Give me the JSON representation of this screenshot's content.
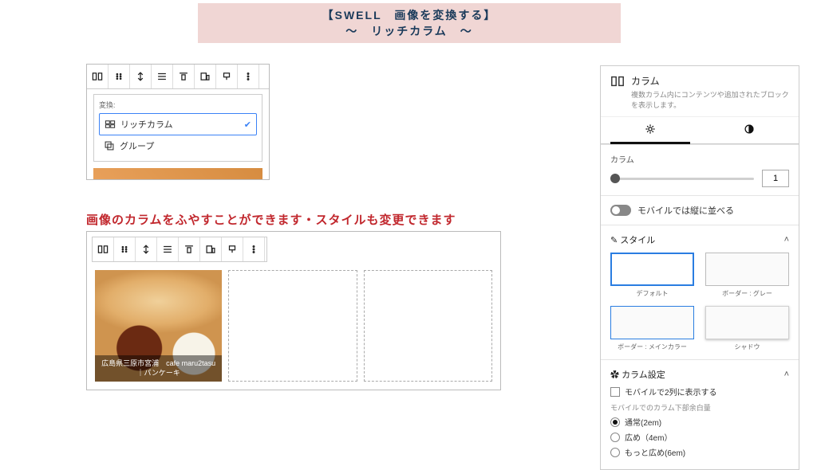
{
  "header": {
    "line1": "【SWELL　画像を変換する】",
    "line2": "〜　リッチカラム　〜"
  },
  "transform": {
    "label": "変換:",
    "options": {
      "rich_column": "リッチカラム",
      "group": "グループ"
    }
  },
  "caption": "画像のカラムをふやすことができます・スタイルも変更できます",
  "image": {
    "caption": "広島県三原市宮浦　cafe maru2tasu｜パンケーキ"
  },
  "sidebar": {
    "block": {
      "title": "カラム",
      "desc": "複数カラム内にコンテンツや追加されたブロックを表示します。"
    },
    "column_section": {
      "label": "カラム",
      "value": "1"
    },
    "mobile_toggle": "モバイルでは縦に並べる",
    "style_section": {
      "title": "スタイル",
      "items": {
        "default": "デフォルト",
        "border_gray": "ボーダー : グレー",
        "border_main": "ボーダー : メインカラー",
        "shadow": "シャドウ"
      }
    },
    "col_settings": {
      "title": "カラム設定",
      "mobile_2col": "モバイルで2列に表示する",
      "margin_label": "モバイルでのカラム下部余白量",
      "margin_opts": {
        "normal": "通常(2em)",
        "wide": "広め（4em）",
        "wider": "もっと広め(6em)"
      }
    }
  }
}
